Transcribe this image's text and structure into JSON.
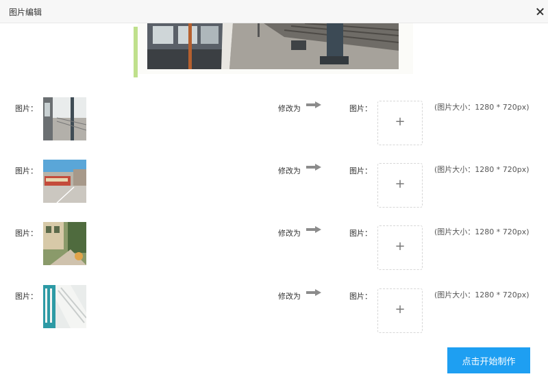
{
  "dialog": {
    "title": "图片编辑",
    "close_icon": "close-icon"
  },
  "rows": [
    {
      "source_label": "图片：",
      "modify_label": "修改为",
      "target_label": "图片：",
      "upload_symbol": "+",
      "size_hint": "(图片大小：1280 * 720px)"
    },
    {
      "source_label": "图片：",
      "modify_label": "修改为",
      "target_label": "图片：",
      "upload_symbol": "+",
      "size_hint": "(图片大小：1280 * 720px)"
    },
    {
      "source_label": "图片：",
      "modify_label": "修改为",
      "target_label": "图片：",
      "upload_symbol": "+",
      "size_hint": "(图片大小：1280 * 720px)"
    },
    {
      "source_label": "图片：",
      "modify_label": "修改为",
      "target_label": "图片：",
      "upload_symbol": "+",
      "size_hint": "(图片大小：1280 * 720px)"
    }
  ],
  "footer": {
    "start_button": "点击开始制作"
  },
  "colors": {
    "accent_bar": "#bfe08c",
    "primary_button": "#1e9ff2",
    "arrow": "#8c8c8c"
  }
}
